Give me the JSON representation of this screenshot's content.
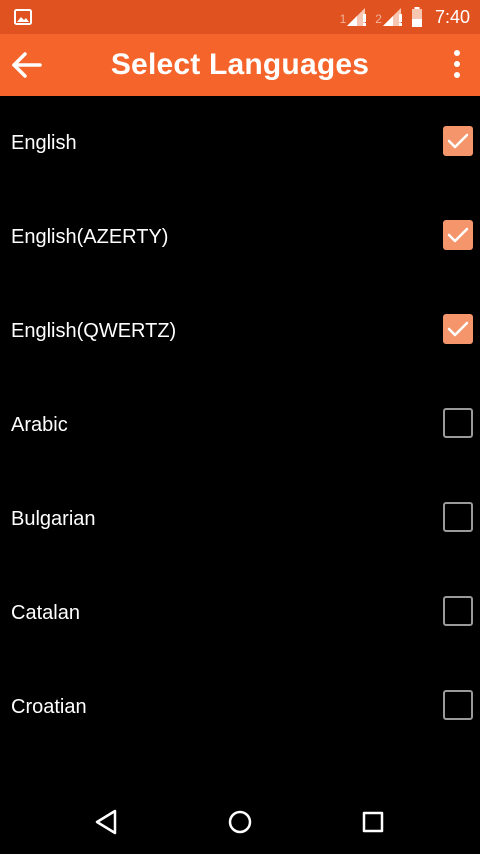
{
  "status_bar": {
    "sim1_label": "1",
    "sim2_label": "2",
    "time": "7:40",
    "icons": [
      "gallery-icon",
      "signal-icon",
      "signal-icon",
      "battery-icon"
    ]
  },
  "app_bar": {
    "title": "Select Languages",
    "back_icon": "arrow-left-icon",
    "menu_icon": "more-vert-icon"
  },
  "languages": [
    {
      "name": "English",
      "checked": true
    },
    {
      "name": "English(AZERTY)",
      "checked": true
    },
    {
      "name": "English(QWERTZ)",
      "checked": true
    },
    {
      "name": "Arabic",
      "checked": false
    },
    {
      "name": "Bulgarian",
      "checked": false
    },
    {
      "name": "Catalan",
      "checked": false
    },
    {
      "name": "Croatian",
      "checked": false
    }
  ],
  "colors": {
    "status_bar": "#e0521f",
    "app_bar": "#f4642b",
    "checkbox_checked": "#f4956c",
    "checkbox_unchecked_border": "#9a9a9a",
    "background": "#000000"
  },
  "nav_bar": {
    "icons": [
      "back-triangle-icon",
      "home-circle-icon",
      "recents-square-icon"
    ]
  }
}
